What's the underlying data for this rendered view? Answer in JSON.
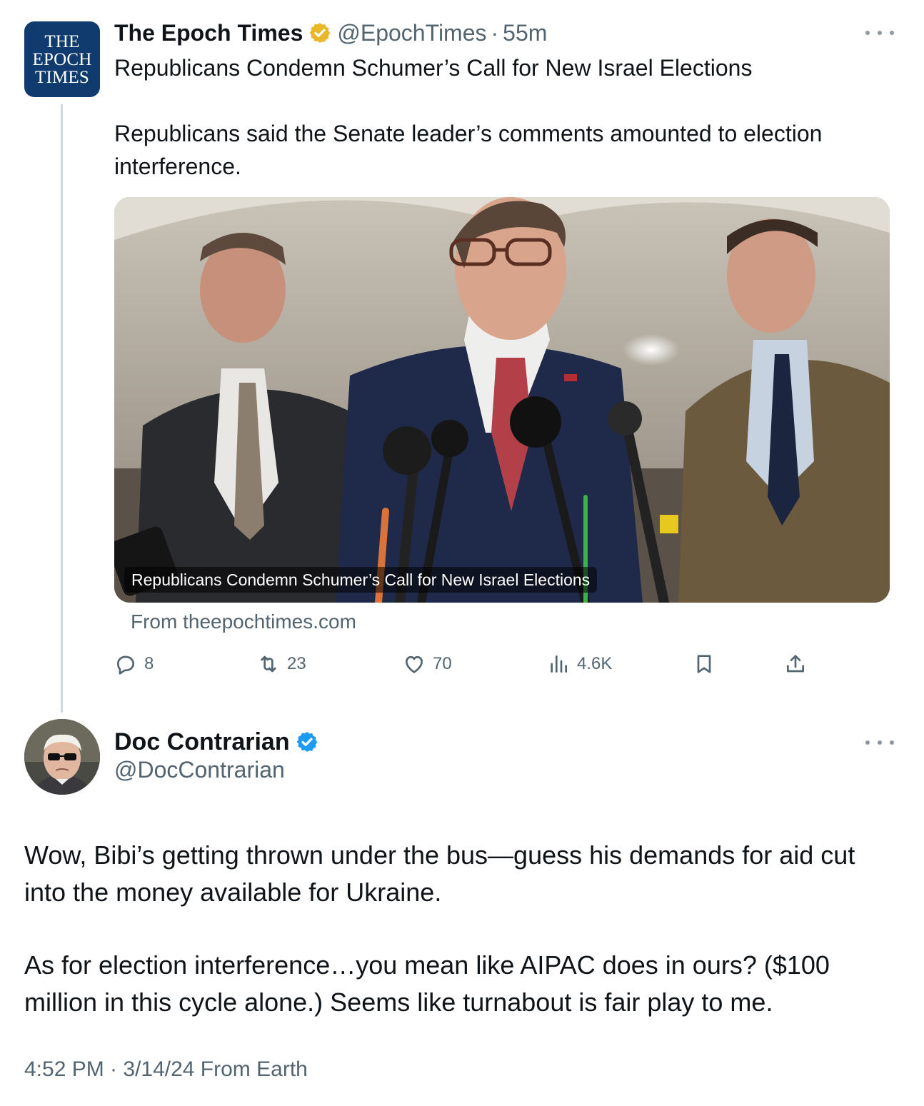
{
  "parent_tweet": {
    "avatar_text": [
      "THE",
      "EPOCH",
      "TIMES"
    ],
    "display_name": "The Epoch Times",
    "verified_badge": "gold-check-badge",
    "handle": "@EpochTimes",
    "separator": "·",
    "time": "55m",
    "text_line1": "Republicans Condemn Schumer’s Call for New Israel Elections",
    "text_para2": "Republicans said the Senate leader’s comments amounted to election interference.",
    "card": {
      "caption": "Republicans Condemn Schumer’s Call for New Israel Elections",
      "source": "From theepochtimes.com"
    },
    "actions": {
      "replies": "8",
      "reposts": "23",
      "likes": "70",
      "views": "4.6K"
    }
  },
  "main_tweet": {
    "display_name": "Doc Contrarian",
    "verified_badge": "blue-check-badge",
    "handle": "@DocContrarian",
    "paragraph1": "Wow, Bibi’s getting thrown under the bus—guess his demands for aid cut into the money available for Ukraine.",
    "paragraph2": "As for election interference…you mean like AIPAC does in ours? ($100 million in this cycle alone.) Seems like turnabout is fair play to me.",
    "meta": "4:52 PM · 3/14/24 From Earth"
  },
  "colors": {
    "text_primary": "#0f1419",
    "text_secondary": "#536471",
    "epoch_blue": "#0f3b6e",
    "gold_badge": "#e8b829",
    "blue_badge": "#1d9bf0",
    "thread_line": "#cfd9de"
  }
}
